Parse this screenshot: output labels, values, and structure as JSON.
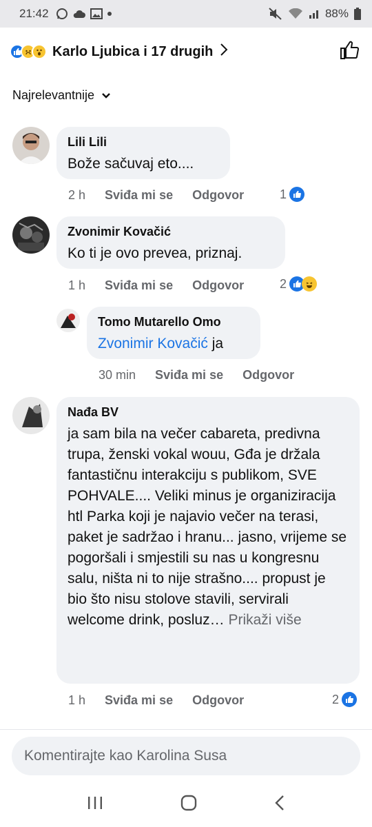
{
  "status_bar": {
    "time": "21:42",
    "battery": "88%"
  },
  "header": {
    "names": "Karlo Ljubica i 17 drugih"
  },
  "sort": {
    "label": "Najrelevantnije"
  },
  "comments": [
    {
      "author": "Lili Lili",
      "text": "Bože sačuvaj eto....",
      "time": "2 h",
      "like": "Sviđa mi se",
      "reply": "Odgovor",
      "reactions": "1"
    },
    {
      "author": "Zvonimir Kovačić",
      "text": "Ko ti je ovo prevea, priznaj.",
      "time": "1 h",
      "like": "Sviđa mi se",
      "reply": "Odgovor",
      "reactions": "2"
    },
    {
      "author": "Tomo Mutarello Omo",
      "mention": "Zvonimir Kovačić",
      "text": " ja",
      "time": "30 min",
      "like": "Sviđa mi se",
      "reply": "Odgovor"
    },
    {
      "author": "Nađa BV",
      "text": "ja sam bila na večer cabareta, predivna trupa, ženski vokal wouu, Gđa je držala fantastičnu interakciju s publikom, SVE POHVALE.... Veliki minus je organiziracija htl Parka koji je najavio večer na terasi, paket je sadržao i hranu... jasno, vrijeme se pogoršali i smjestili su nas u kongresnu salu, ništa ni to nije strašno.... propust je bio što nisu stolove stavili, servirali welcome drink, posluz…",
      "more": "Prikaži više",
      "time": "1 h",
      "like": "Sviđa mi se",
      "reply": "Odgovor",
      "reactions": "2"
    }
  ],
  "composer": {
    "placeholder": "Komentirajte kao Karolina Susa"
  },
  "colors": {
    "like_blue": "#1b74e4",
    "bubble": "#f0f2f5",
    "meta_gray": "#65676b"
  }
}
